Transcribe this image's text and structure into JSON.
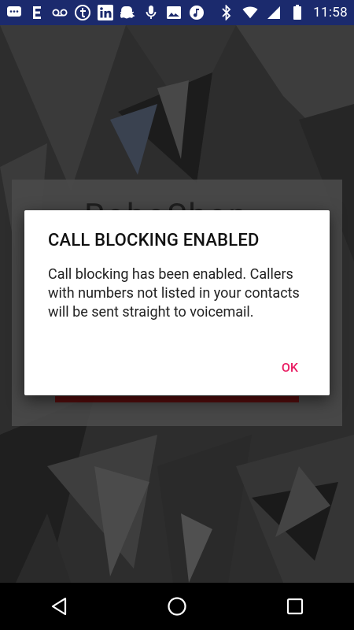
{
  "status_bar": {
    "time": "11:58",
    "left_icons": [
      "messages-icon",
      "e-icon",
      "voicemail-icon",
      "tumblr-icon",
      "linkedin-icon",
      "snapchat-icon",
      "mic-icon",
      "image-icon",
      "music-icon"
    ],
    "right_icons": [
      "bluetooth-icon",
      "wifi-icon",
      "signal-icon",
      "battery-icon"
    ]
  },
  "background_app": {
    "logo_text": "RoboShop"
  },
  "dialog": {
    "title": "CALL BLOCKING ENABLED",
    "message": "Call blocking has been enabled. Callers with numbers not listed in your contacts will be sent straight to voicemail.",
    "ok_label": "OK"
  },
  "colors": {
    "status_bar": "#1b2a6d",
    "accent": "#e91e63"
  },
  "nav_bar": {
    "buttons": [
      "back-icon",
      "home-icon",
      "recents-icon"
    ]
  }
}
